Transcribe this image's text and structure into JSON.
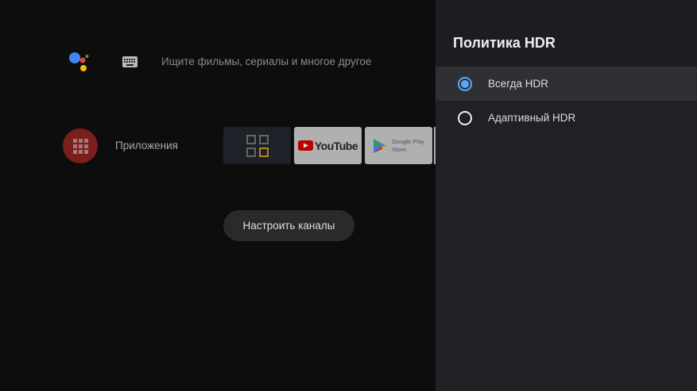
{
  "home": {
    "search_placeholder": "Ищите фильмы, сериалы и многое другое",
    "apps_label": "Приложения",
    "tiles": [
      {
        "name": "Apps"
      },
      {
        "name": "YouTube"
      },
      {
        "name": "Google Play",
        "sub": "Store"
      }
    ],
    "channels_button": "Настроить каналы"
  },
  "panel": {
    "title": "Политика HDR",
    "options": [
      {
        "label": "Всегда HDR",
        "selected": true
      },
      {
        "label": "Адаптивный HDR",
        "selected": false
      }
    ]
  },
  "colors": {
    "accent": "#5aa9f5",
    "apps": "#7a1f1c"
  }
}
